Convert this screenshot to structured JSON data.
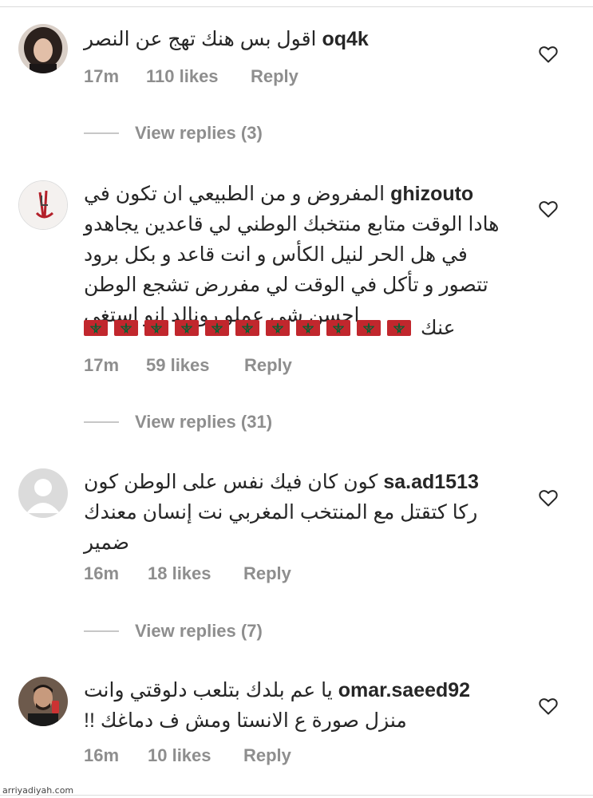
{
  "comments": [
    {
      "username": "oq4k",
      "text": "اقول بس هنك تهج عن النصر",
      "time": "17m",
      "likes": "110 likes",
      "reply": "Reply",
      "view_replies": "View replies (3)"
    },
    {
      "username": "ghizouto",
      "text": "المفروض و من الطبيعي ان تكون في هادا الوقت متابع منتخبك الوطني لي قاعدين يجاهدو في هل الحر لنيل الكأس و انت قاعد و بكل برود تتصور و تأكل في الوقت لي مفررض تشجع الوطن احسن شي عملو رونالد انو إستغى",
      "text_tail": "عنك",
      "flag_count": 11,
      "time": "17m",
      "likes": "59 likes",
      "reply": "Reply",
      "view_replies": "View replies (31)"
    },
    {
      "username": "sa.ad1513",
      "text": "كون كان فيك نفس على الوطن كون ركا كتقتل مع المنتخب المغربي نت إنسان معندك ضمير",
      "time": "16m",
      "likes": "18 likes",
      "reply": "Reply",
      "view_replies": "View replies (7)"
    },
    {
      "username": "omar.saeed92",
      "text": "يا عم بلدك بتلعب دلوقتي وانت منزل صورة ع الانستا ومش ف دماغك !!",
      "time": "16m",
      "likes": "10 likes",
      "reply": "Reply"
    }
  ],
  "watermark": "arriyadiyah.com",
  "colors": {
    "meta": "#8e8e8e",
    "text": "#262626",
    "flag_red": "#c1272d",
    "flag_star": "#006233"
  },
  "icons": {
    "like": "heart-outline-icon",
    "default_avatar": "default-avatar-icon"
  }
}
